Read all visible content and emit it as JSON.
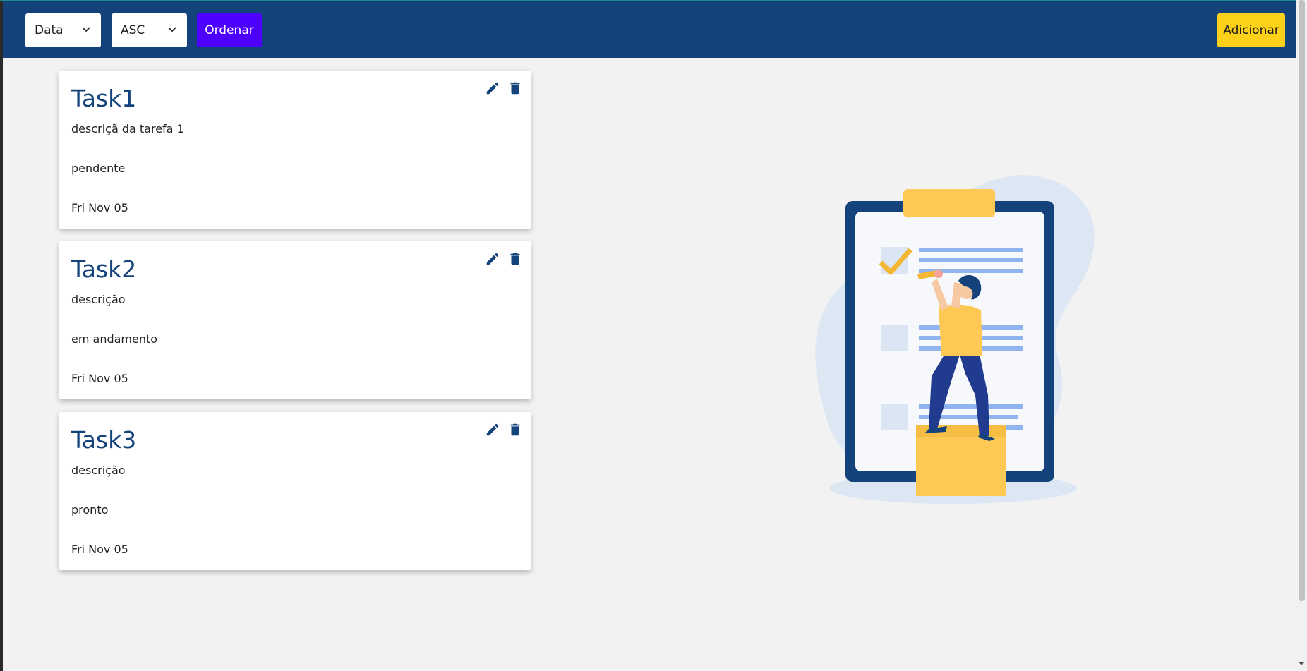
{
  "toolbar": {
    "sort_field": "Data",
    "sort_order": "ASC",
    "order_button": "Ordenar",
    "add_button": "Adicionar"
  },
  "tasks": [
    {
      "title": "Task1",
      "description": "descriçã da tarefa 1",
      "status": "pendente",
      "date": "Fri Nov 05"
    },
    {
      "title": "Task2",
      "description": "descrição",
      "status": "em andamento",
      "date": "Fri Nov 05"
    },
    {
      "title": "Task3",
      "description": "descrição",
      "status": "pronto",
      "date": "Fri Nov 05"
    }
  ],
  "icons": {
    "edit": "pencil-icon",
    "delete": "trash-icon",
    "dropdown": "chevron-down-icon"
  },
  "colors": {
    "header": "#13437a",
    "order_button": "#4e00ff",
    "add_button": "#fdd11a",
    "title": "#13437a"
  }
}
